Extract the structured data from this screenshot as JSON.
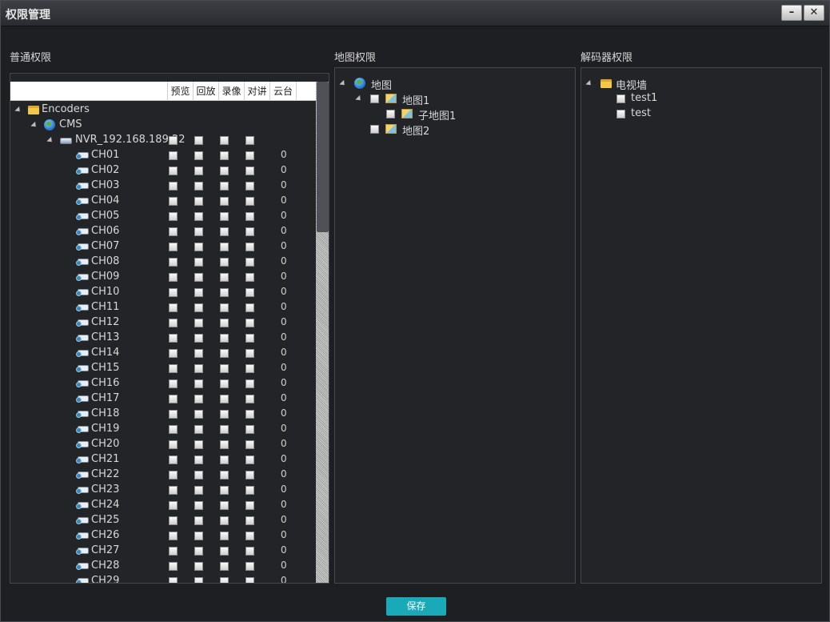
{
  "window": {
    "title": "权限管理",
    "min_glyph": "–",
    "close_glyph": "✕"
  },
  "sections": {
    "general": "普通权限",
    "map": "地图权限",
    "decoder": "解码器权限"
  },
  "columns": [
    "预览",
    "回放",
    "录像",
    "对讲",
    "云台"
  ],
  "tree": {
    "root": "Encoders",
    "cms": "CMS",
    "nvr": "NVR_192.168.189.22",
    "channels": [
      "CH01",
      "CH02",
      "CH03",
      "CH04",
      "CH05",
      "CH06",
      "CH07",
      "CH08",
      "CH09",
      "CH10",
      "CH11",
      "CH12",
      "CH13",
      "CH14",
      "CH15",
      "CH16",
      "CH17",
      "CH18",
      "CH19",
      "CH20",
      "CH21",
      "CH22",
      "CH23",
      "CH24",
      "CH25",
      "CH26",
      "CH27",
      "CH28",
      "CH29"
    ],
    "ptz_value": "0"
  },
  "map_tree": {
    "root": "地图",
    "map1": "地图1",
    "submap1": "子地图1",
    "map2": "地图2"
  },
  "decoder_tree": {
    "root": "电视墙",
    "items": [
      "test1",
      "test"
    ]
  },
  "save_label": "保存",
  "icons": [
    "folder-icon",
    "globe-icon",
    "nvr-icon",
    "camera-icon",
    "map-icon",
    "checkbox",
    "expand-arrow-icon",
    "scrollbar"
  ]
}
